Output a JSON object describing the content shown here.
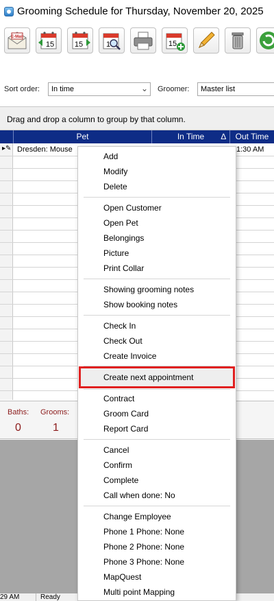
{
  "window": {
    "title": "Grooming Schedule for Thursday, November 20, 2025"
  },
  "toolbar": {
    "buttons": [
      {
        "icon": "email-icon",
        "text": "E-Mail"
      },
      {
        "icon": "previous-day-calendar-icon",
        "text": "15"
      },
      {
        "icon": "next-day-calendar-icon",
        "text": "15"
      },
      {
        "icon": "find-calendar-icon",
        "text": "1"
      },
      {
        "icon": "printer-icon"
      },
      {
        "icon": "add-calendar-icon",
        "text": "15"
      },
      {
        "icon": "pencil-icon"
      },
      {
        "icon": "trash-can-icon"
      },
      {
        "icon": "refresh-icon"
      }
    ]
  },
  "filters": {
    "sort_label": "Sort order:",
    "sort_value": "In time",
    "groomer_label": "Groomer:",
    "groomer_value": "Master list"
  },
  "group_panel": {
    "text": "Drag and drop a column to group by that column."
  },
  "grid": {
    "columns": [
      "Pet",
      "In Time",
      "Out Time"
    ],
    "sort_indicator": "∆",
    "rows": [
      {
        "pet": "Dresden: Mouse",
        "out_time": "1:30 AM"
      }
    ]
  },
  "summary": {
    "baths_label": "Baths:",
    "baths_value": "0",
    "grooms_label": "Grooms:",
    "grooms_value": "1"
  },
  "statusbar": {
    "time": "29 AM",
    "state": "Ready"
  },
  "context_menu": {
    "items": [
      "Add",
      "Modify",
      "Delete",
      "Open Customer",
      "Open Pet",
      "Belongings",
      "Picture",
      "Print Collar",
      "Showing grooming notes",
      "Show booking notes",
      "Check In",
      "Check Out",
      "Create Invoice",
      "Create next appointment",
      "Contract",
      "Groom Card",
      "Report Card",
      "Cancel",
      "Confirm",
      "Complete",
      "Call when done: No",
      "Change Employee",
      "Phone 1 Phone: None",
      "Phone 2 Phone: None",
      "Phone 3 Phone: None",
      "MapQuest",
      "Multi point Mapping"
    ],
    "highlighted": "Create next appointment"
  },
  "colors": {
    "header_bg": "#0e2c86",
    "highlight_border": "#e02020",
    "summary_text": "#8b1a1a"
  }
}
